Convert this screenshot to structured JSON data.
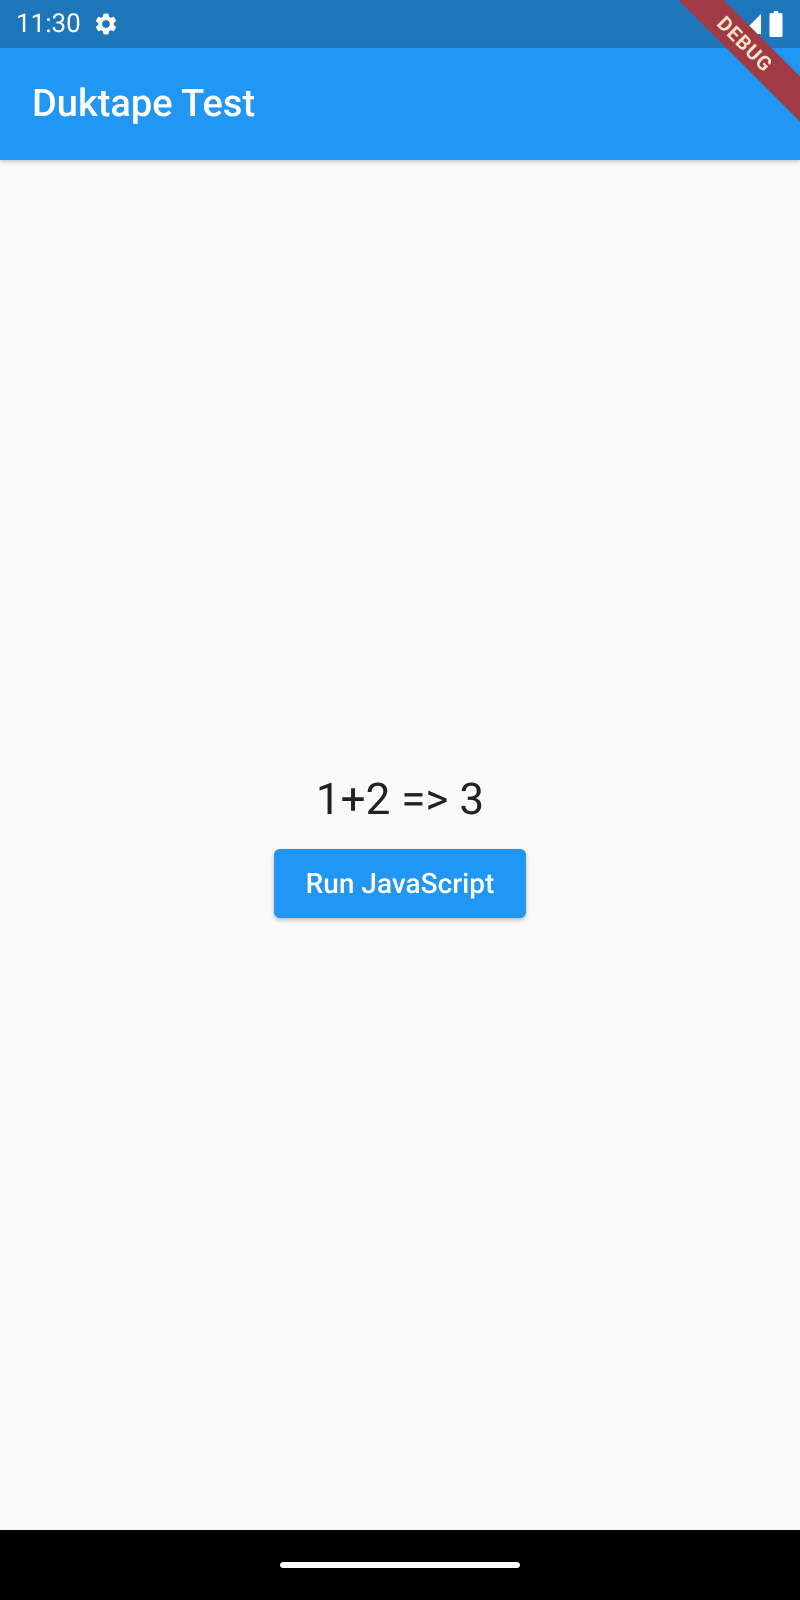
{
  "status_bar": {
    "time": "11:30",
    "gear_icon": "gear-icon",
    "wifi_icon": "wifi-icon",
    "signal_icon": "signal-icon",
    "battery_icon": "battery-icon"
  },
  "debug_banner": {
    "label": "DEBUG"
  },
  "app_bar": {
    "title": "Duktape Test"
  },
  "main": {
    "result_text": "1+2 => 3",
    "run_button_label": "Run JavaScript"
  },
  "colors": {
    "status_bg": "#1e76ba",
    "app_bar_bg": "#2196f3",
    "button_bg": "#2196f3",
    "debug_ribbon": "#a03a45"
  }
}
